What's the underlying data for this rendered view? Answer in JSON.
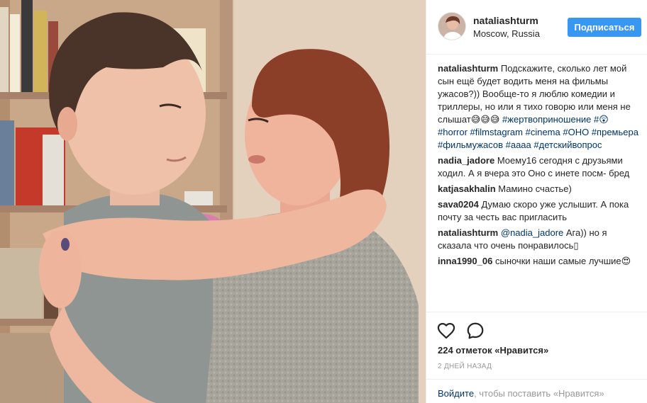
{
  "post": {
    "author": "nataliashturm",
    "location": "Moscow, Russia",
    "follow_label": "Подписаться"
  },
  "caption": {
    "user": "nataliashturm",
    "text": "Подскажите, сколько лет мой сын ещё будет водить меня на фильмы ужасов?)) Вообще-то я люблю комедии и триллеры, но или я тихо говорю или меня не слышат😅😅😅",
    "tags": [
      "#жертвоприношение",
      "#😲",
      "#horror",
      "#filmstagram",
      "#cinema",
      "#ОНО",
      "#премьера",
      "#фильмужасов",
      "#аааа",
      "#детскийвопрос"
    ]
  },
  "comments": [
    {
      "user": "nadia_jadore",
      "text": "Моему16 сегодня с друзьями ходил. А я вчера это Оно с инете посм- бред"
    },
    {
      "user": "katjasakhalin",
      "text": "Мамино счастье)"
    },
    {
      "user": "sava0204",
      "text": "Думаю скоро уже услышит. А пока почту за честь вас пригласить"
    },
    {
      "user": "nataliashturm",
      "mention": "@nadia_jadore",
      "text": "Ага)) но я сказала что очень понравилось▯"
    },
    {
      "user": "inna1990_06",
      "text": "сыночки наши самые лучшие😍"
    }
  ],
  "stats": {
    "likes": "224 отметок «Нравится»",
    "age": "2 ДНЕЙ НАЗАД"
  },
  "login": {
    "link": "Войдите",
    "rest": ", чтобы поставить «Нравится»"
  },
  "icons": {
    "like": "heart-icon",
    "comment": "comment-bubble-icon"
  },
  "colors": {
    "follow_button": "#3897f0",
    "link": "#003569",
    "muted": "#999999",
    "divider": "#efefef"
  }
}
